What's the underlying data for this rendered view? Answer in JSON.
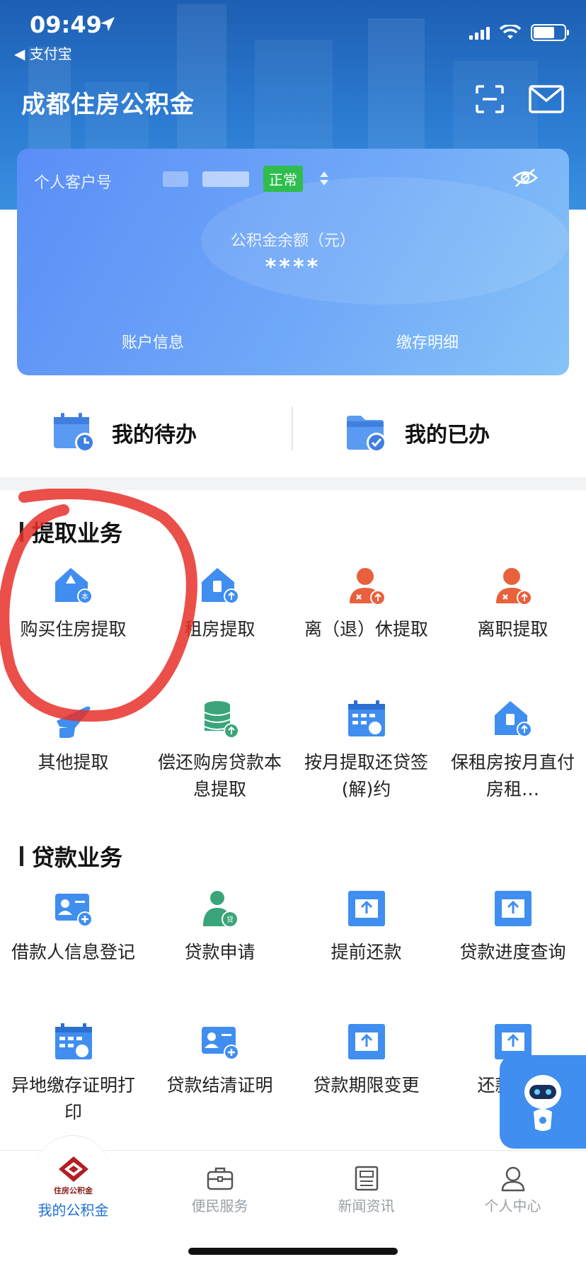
{
  "status_bar": {
    "time": "09:49",
    "back_app": "◀ 支付宝"
  },
  "header": {
    "title": "成都住房公积金"
  },
  "account_card": {
    "customer_label": "个人客户号",
    "status_badge": "正常",
    "balance_label": "公积金余额（元）",
    "balance_value": "****",
    "link_account_info": "账户信息",
    "link_deposit_detail": "缴存明细"
  },
  "todo": {
    "pending_label": "我的待办",
    "done_label": "我的已办"
  },
  "withdraw_section": {
    "title": "提取业务",
    "items": [
      {
        "label": "购买住房提取",
        "icon": "house-buy-icon"
      },
      {
        "label": "租房提取",
        "icon": "house-rent-icon"
      },
      {
        "label": "离（退）休提取",
        "icon": "retire-icon"
      },
      {
        "label": "离职提取",
        "icon": "resign-icon"
      },
      {
        "label": "其他提取",
        "icon": "plane-icon"
      },
      {
        "label": "偿还购房贷款本息提取",
        "icon": "coins-icon"
      },
      {
        "label": "按月提取还贷签(解)约",
        "icon": "calendar-icon"
      },
      {
        "label": "保租房按月直付房租…",
        "icon": "house-rent-icon"
      }
    ]
  },
  "loan_section": {
    "title": "贷款业务",
    "items": [
      {
        "label": "借款人信息登记",
        "icon": "id-card-add-icon"
      },
      {
        "label": "贷款申请",
        "icon": "loan-person-icon"
      },
      {
        "label": "提前还款",
        "icon": "upload-tray-icon"
      },
      {
        "label": "贷款进度查询",
        "icon": "upload-tray-icon"
      },
      {
        "label": "异地缴存证明打印",
        "icon": "calendar-icon"
      },
      {
        "label": "贷款结清证明",
        "icon": "id-card-add-icon"
      },
      {
        "label": "贷款期限变更",
        "icon": "upload-tray-icon"
      },
      {
        "label": "还款变更",
        "icon": "upload-tray-icon"
      }
    ]
  },
  "tabbar": {
    "logo_caption": "住房公积金",
    "tabs": [
      {
        "label": "我的公积金",
        "active": true
      },
      {
        "label": "便民服务",
        "active": false
      },
      {
        "label": "新闻资讯",
        "active": false
      },
      {
        "label": "个人中心",
        "active": false
      }
    ]
  },
  "colors": {
    "primary": "#1d6fd8",
    "icon_blue": "#3f8ef0",
    "icon_orange": "#e8603c",
    "icon_green": "#3aa57a",
    "badge_green": "#2fbd4e",
    "annotation_red": "#e8302a"
  }
}
